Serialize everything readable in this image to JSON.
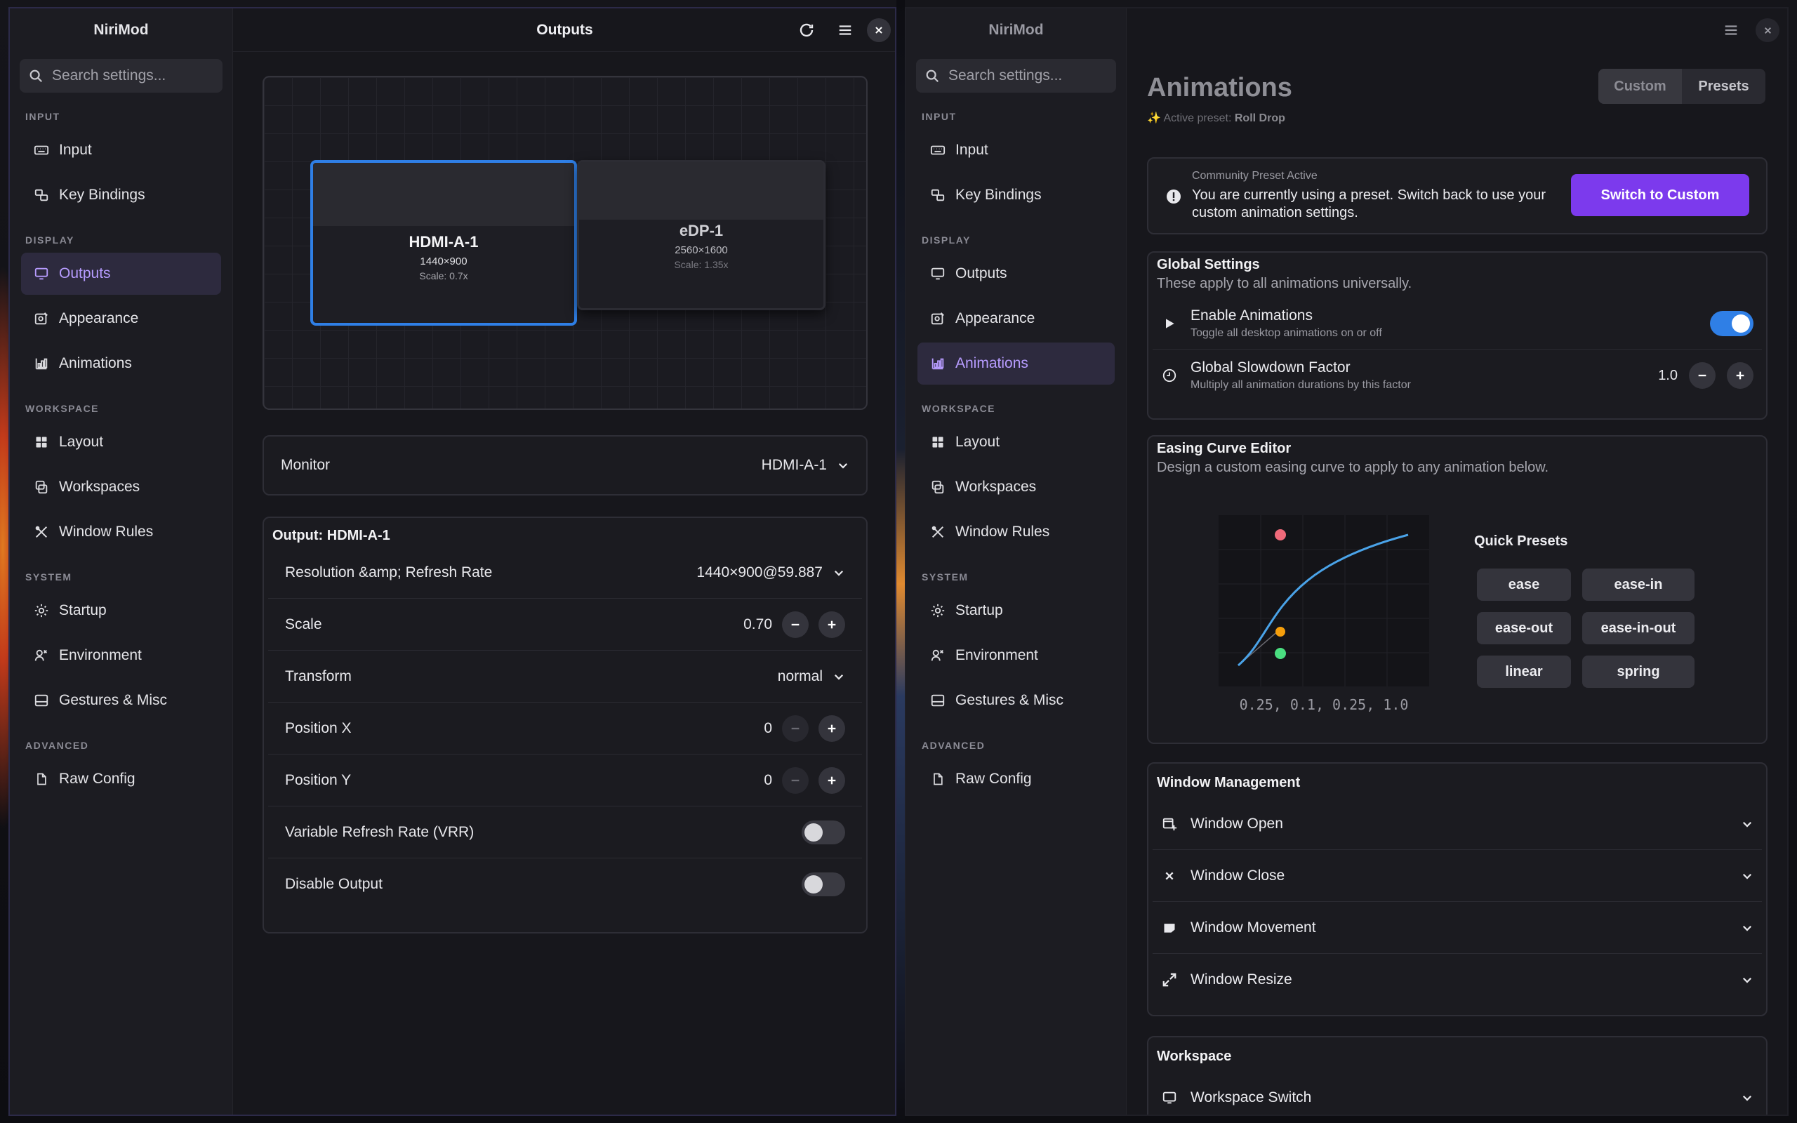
{
  "left_window": {
    "app_name": "NiriMod",
    "title": "Outputs",
    "search_placeholder": "Search settings...",
    "sections": {
      "input": "INPUT",
      "display": "DISPLAY",
      "workspace": "WORKSPACE",
      "system": "SYSTEM",
      "advanced": "ADVANCED"
    },
    "nav": {
      "input": "Input",
      "key_bindings": "Key Bindings",
      "outputs": "Outputs",
      "appearance": "Appearance",
      "animations": "Animations",
      "layout": "Layout",
      "workspaces": "Workspaces",
      "window_rules": "Window Rules",
      "startup": "Startup",
      "environment": "Environment",
      "gestures": "Gestures & Misc",
      "raw_config": "Raw Config"
    },
    "active_nav": "outputs",
    "monitors": [
      {
        "name": "HDMI-A-1",
        "resolution": "1440×900",
        "scale": "Scale: 0.7x",
        "selected": true
      },
      {
        "name": "eDP-1",
        "resolution": "2560×1600",
        "scale": "Scale: 1.35x",
        "selected": false
      }
    ],
    "monitor_select": {
      "label": "Monitor",
      "value": "HDMI-A-1"
    },
    "output_card": {
      "title": "Output: HDMI-A-1",
      "resolution_label": "Resolution &amp; Refresh Rate",
      "resolution_value": "1440×900@59.887",
      "scale_label": "Scale",
      "scale_value": "0.70",
      "transform_label": "Transform",
      "transform_value": "normal",
      "pos_x_label": "Position X",
      "pos_x_value": "0",
      "pos_y_label": "Position Y",
      "pos_y_value": "0",
      "vrr_label": "Variable Refresh Rate (VRR)",
      "vrr_on": false,
      "disable_label": "Disable Output",
      "disable_on": false
    }
  },
  "right_window": {
    "app_name": "NiriMod",
    "search_placeholder": "Search settings...",
    "active_nav": "animations",
    "page_title": "Animations",
    "active_preset_label": "Active preset:",
    "active_preset_value": "Roll Drop",
    "tabs": {
      "custom": "Custom",
      "presets": "Presets"
    },
    "banner": {
      "title": "Community Preset Active",
      "text": "You are currently using a preset. Switch back to use your custom animation settings.",
      "button": "Switch to Custom"
    },
    "global": {
      "title": "Global Settings",
      "subtitle": "These apply to all animations universally.",
      "enable_label": "Enable Animations",
      "enable_desc": "Toggle all desktop animations on or off",
      "enable_on": true,
      "slowdown_label": "Global Slowdown Factor",
      "slowdown_desc": "Multiply all animation durations by this factor",
      "slowdown_value": "1.0"
    },
    "easing": {
      "title": "Easing Curve Editor",
      "subtitle": "Design a custom easing curve to apply to any animation below.",
      "values": "0.25, 0.1, 0.25, 1.0",
      "quick_presets_label": "Quick Presets",
      "presets": [
        "ease",
        "ease-in",
        "ease-out",
        "ease-in-out",
        "linear",
        "spring"
      ]
    },
    "window_management": {
      "title": "Window Management",
      "items": [
        "Window Open",
        "Window Close",
        "Window Movement",
        "Window Resize"
      ]
    },
    "workspace": {
      "title": "Workspace",
      "items": [
        "Workspace Switch"
      ]
    }
  },
  "colors": {
    "accent_purple": "#7c3aed",
    "accent_blue": "#2f7fe6",
    "nav_active_text": "#b79cff",
    "curve_blue": "#4aa3e8",
    "handle_red": "#f06a7a",
    "handle_green": "#4ade80",
    "handle_orange": "#f59e0b"
  }
}
